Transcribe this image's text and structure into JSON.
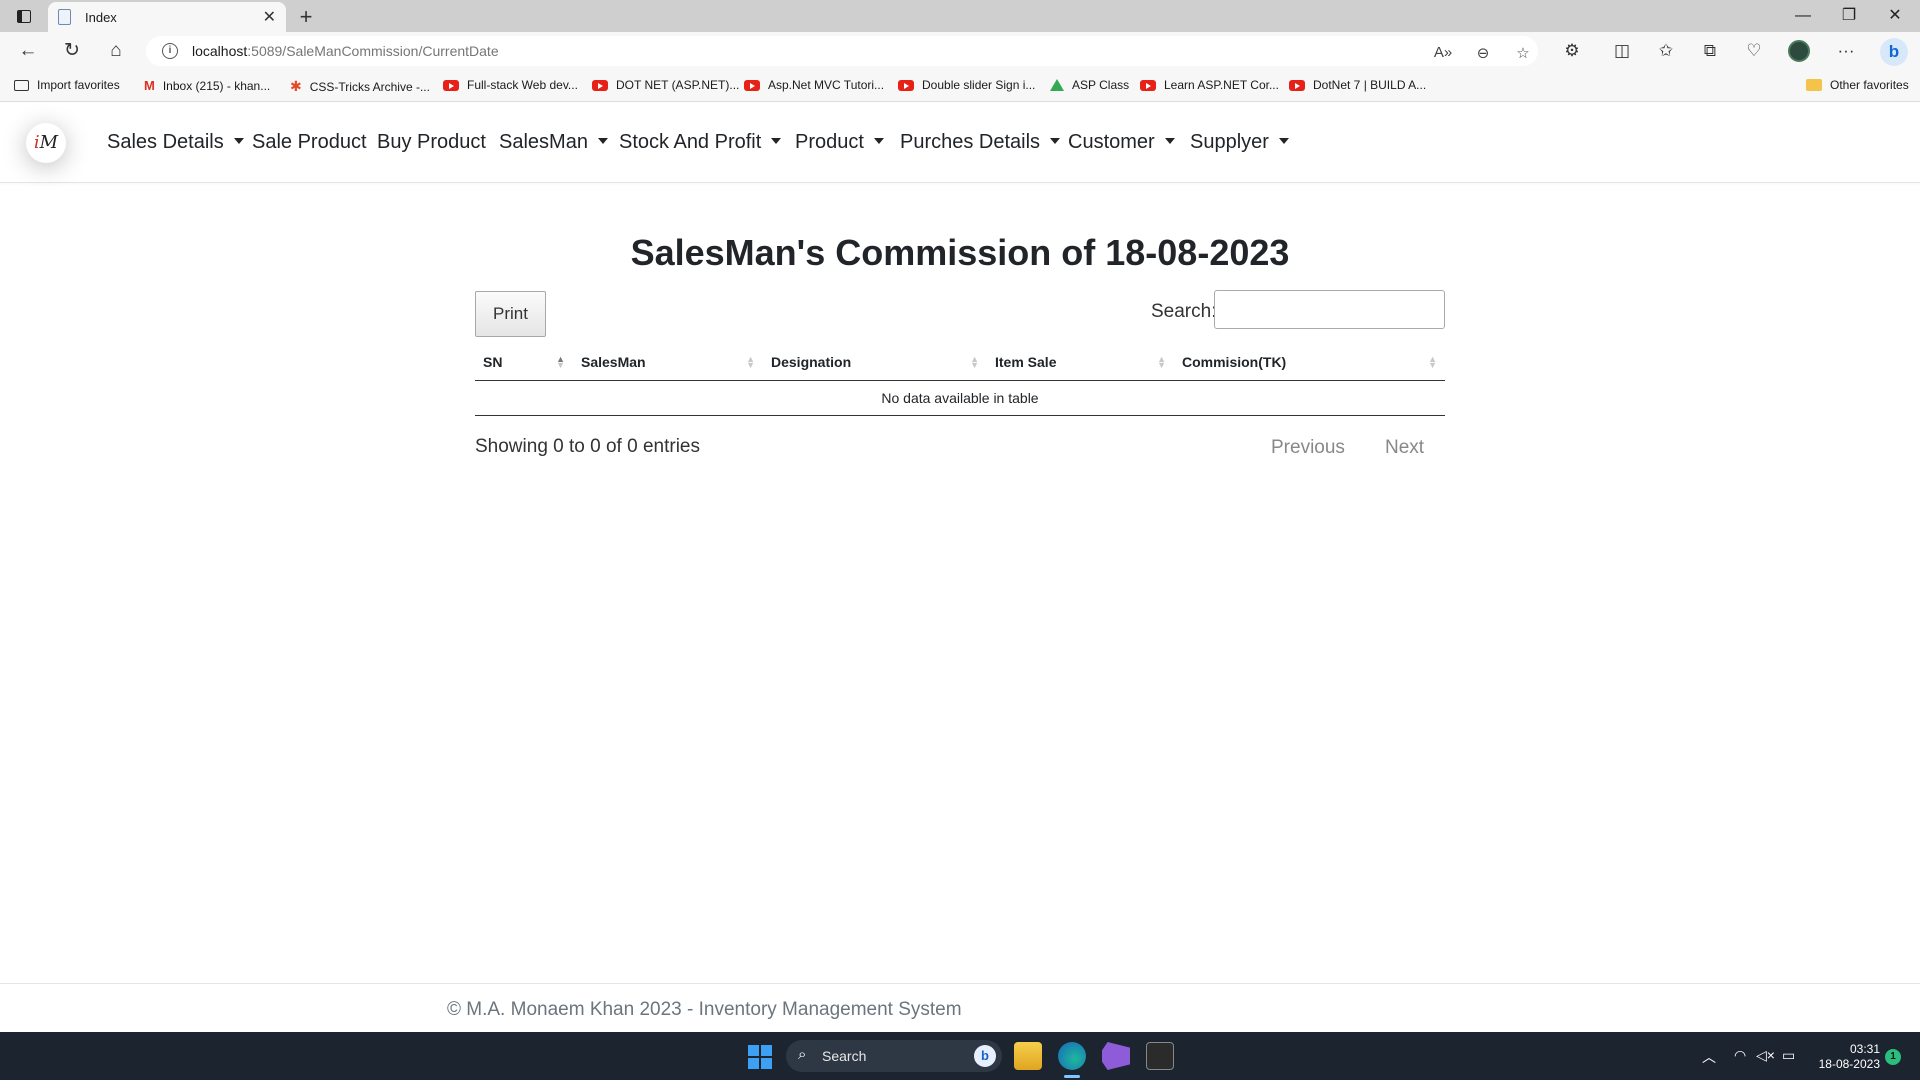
{
  "browser": {
    "tab_title": "Index",
    "url_host": "localhost",
    "url_path": ":5089/SaleManCommission/CurrentDate",
    "favorites": [
      "Import favorites",
      "Inbox (215) - khan...",
      "CSS-Tricks Archive -...",
      "Full-stack Web dev...",
      "DOT NET (ASP.NET)...",
      "Asp.Net MVC Tutori...",
      "Double slider Sign i...",
      "ASP Class",
      "Learn ASP.NET Cor...",
      "DotNet 7 | BUILD A..."
    ],
    "other_favorites": "Other favorites"
  },
  "site": {
    "logo_text": "M",
    "nav": [
      {
        "label": "Sales Details",
        "dropdown": true
      },
      {
        "label": "Sale Product",
        "dropdown": false
      },
      {
        "label": "Buy Product",
        "dropdown": false
      },
      {
        "label": "SalesMan",
        "dropdown": true
      },
      {
        "label": "Stock And Profit",
        "dropdown": true
      },
      {
        "label": "Product",
        "dropdown": true
      },
      {
        "label": "Purches Details",
        "dropdown": true
      },
      {
        "label": "Customer",
        "dropdown": true
      },
      {
        "label": "Supplyer",
        "dropdown": true
      }
    ]
  },
  "main": {
    "title": "SalesMan's Commission of 18-08-2023",
    "print_label": "Print",
    "search_label": "Search:",
    "search_value": "",
    "columns": [
      "SN",
      "SalesMan",
      "Designation",
      "Item Sale",
      "Commision(TK)"
    ],
    "empty_message": "No data available in table",
    "info": "Showing 0 to 0 of 0 entries",
    "prev_label": "Previous",
    "next_label": "Next"
  },
  "footer": {
    "text": "© M.A. Monaem Khan 2023 - Inventory Management System"
  },
  "taskbar": {
    "search_label": "Search",
    "time": "03:31",
    "date": "18-08-2023",
    "notification_count": "1"
  }
}
